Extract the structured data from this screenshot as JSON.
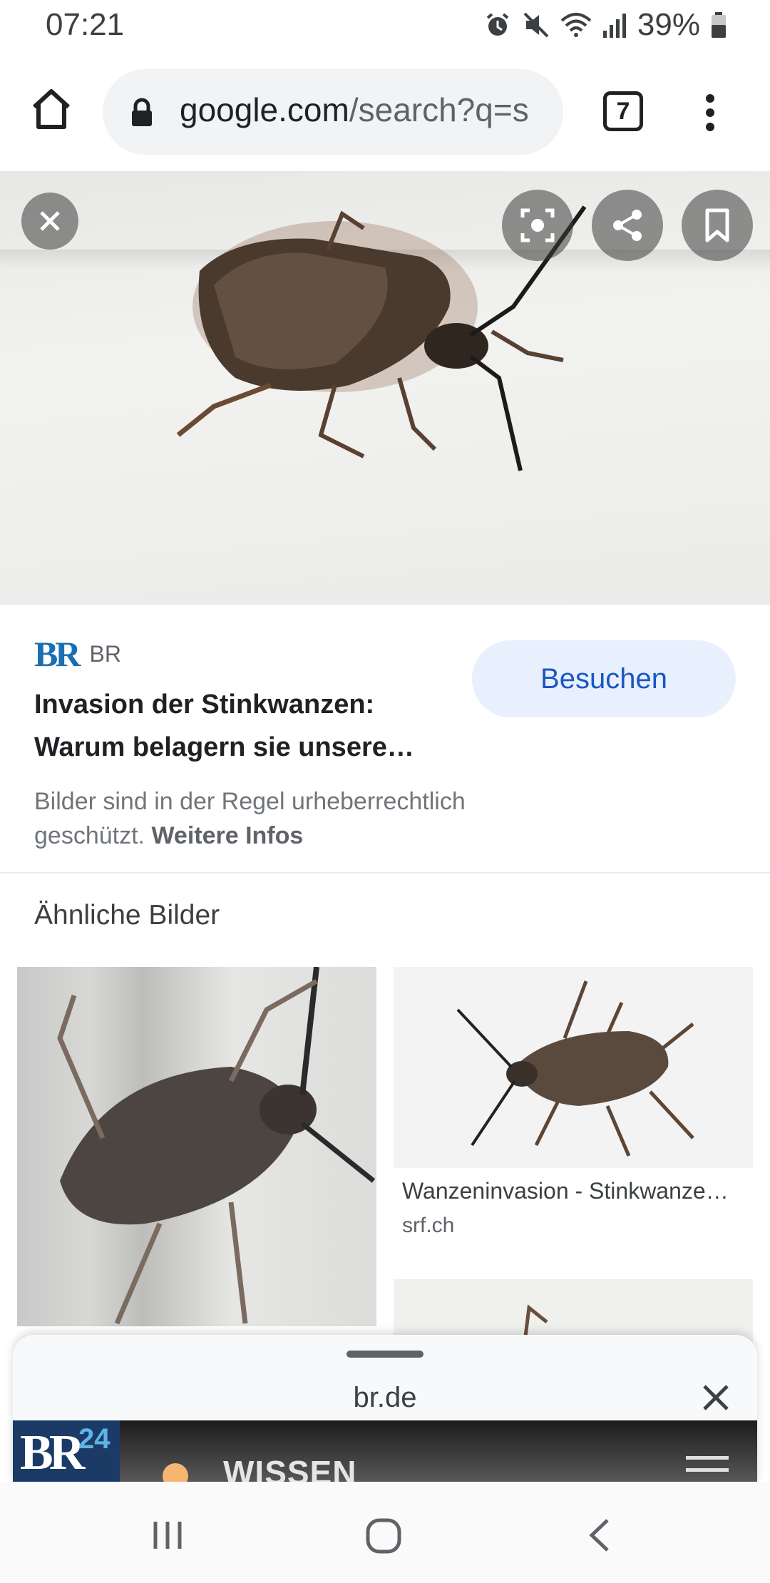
{
  "status_bar": {
    "time": "07:21",
    "battery": "39%",
    "icons": [
      "alarm-icon",
      "mute-icon",
      "wifi-icon",
      "signal-icon",
      "battery-icon"
    ]
  },
  "browser": {
    "url_domain": "google.com",
    "url_rest": "/search?q=s",
    "tab_count": "7"
  },
  "image_viewer": {
    "source_name": "BR",
    "source_logo": "BR",
    "title_line1": "Invasion der Stinkwanzen:",
    "title_line2": "Warum belagern sie unsere…",
    "visit_label": "Besuchen",
    "copyright_text": "Bilder sind in der Regel urheberrechtlich geschützt.",
    "copyright_link": "Weitere Infos"
  },
  "similar": {
    "section_title": "Ähnliche Bilder",
    "items": [
      {
        "title": "Wanzeninvasion - Stinkwanze…",
        "source": "srf.ch"
      }
    ]
  },
  "bottom_sheet": {
    "domain": "br.de",
    "logo_text": "BR",
    "logo_number": "24",
    "section_label": "WISSEN"
  },
  "colors": {
    "accent": "#1a57c2",
    "visit_bg": "#e8f0fe",
    "br_blue": "#1a6fb3"
  }
}
